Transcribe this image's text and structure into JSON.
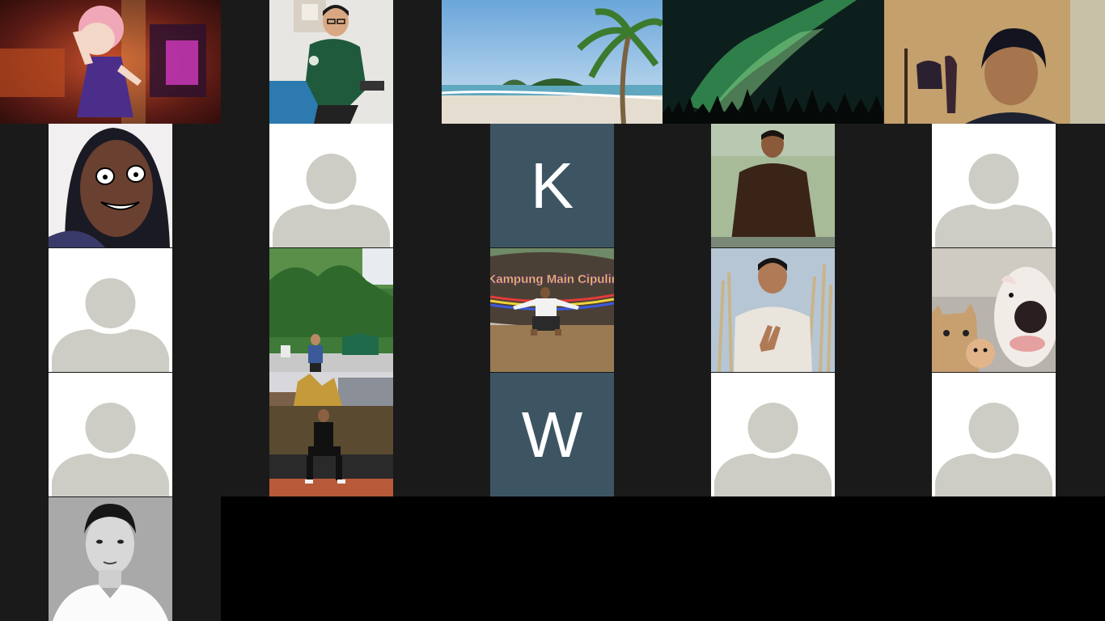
{
  "meeting": {
    "view": "gallery",
    "colors": {
      "background": "#1a1a1a",
      "initial_tile": "#3d5563",
      "placeholder_tile": "#ffffff",
      "avatar_gray": "#cdcdc5"
    },
    "tiles": [
      {
        "type": "image",
        "depicts": "anime character dancing on stage"
      },
      {
        "type": "image",
        "depicts": "young man with glasses in green jacket"
      },
      {
        "type": "image",
        "depicts": "tropical beach with palm tree"
      },
      {
        "type": "image",
        "depicts": "aurora over forest"
      },
      {
        "type": "image",
        "depicts": "man at webcam in room"
      },
      {
        "type": "image",
        "depicts": "person with drawn cartoon face"
      },
      {
        "type": "avatar",
        "icon": "default-avatar-icon"
      },
      {
        "type": "initial",
        "initial": "K"
      },
      {
        "type": "image",
        "depicts": "man sitting by a lake"
      },
      {
        "type": "avatar",
        "icon": "default-avatar-icon"
      },
      {
        "type": "avatar",
        "icon": "default-avatar-icon"
      },
      {
        "type": "image",
        "depicts": "collage of man in forest and at fountain"
      },
      {
        "type": "image",
        "depicts": "man sitting in front of Kampung Main Cipulir sign"
      },
      {
        "type": "image",
        "depicts": "man making peace sign outdoors"
      },
      {
        "type": "image",
        "depicts": "cat, hamster and dog faces"
      },
      {
        "type": "avatar",
        "icon": "default-avatar-icon"
      },
      {
        "type": "initial",
        "initial": "W"
      },
      {
        "type": "avatar",
        "icon": "default-avatar-icon"
      },
      {
        "type": "avatar",
        "icon": "default-avatar-icon"
      },
      {
        "type": "image",
        "depicts": "black and white portrait of man in white shirt"
      }
    ],
    "sign_text": "Kampung Main Cipulir"
  }
}
